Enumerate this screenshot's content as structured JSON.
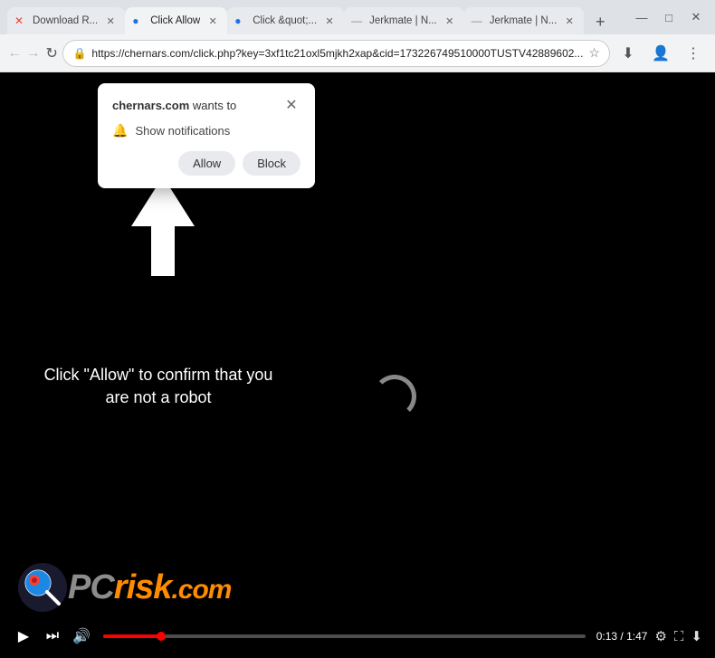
{
  "browser": {
    "tabs": [
      {
        "id": "tab1",
        "favicon": "✕",
        "title": "Download R...",
        "active": false,
        "favicon_color": "red"
      },
      {
        "id": "tab2",
        "favicon": "◉",
        "title": "Click Allow",
        "active": true,
        "favicon_color": "blue"
      },
      {
        "id": "tab3",
        "favicon": "◉",
        "title": "Click &quot;...",
        "active": false,
        "favicon_color": "blue"
      },
      {
        "id": "tab4",
        "favicon": "◉",
        "title": "Jerkmate | N...",
        "active": false,
        "favicon_color": "gray"
      },
      {
        "id": "tab5",
        "favicon": "◉",
        "title": "Jerkmate | N...",
        "active": false,
        "favicon_color": "gray"
      }
    ],
    "new_tab_label": "+",
    "window_controls": {
      "minimize": "—",
      "maximize": "□",
      "close": "✕"
    },
    "nav": {
      "back": "←",
      "forward": "→",
      "refresh": "↻"
    },
    "address": "https://chernars.com/click.php?key=3xf1tc21oxl5mjkh2xap&cid=173226749510000TUSTV42889602...",
    "address_icon": "🔒",
    "star_icon": "☆",
    "download_icon": "⬇",
    "profile_icon": "👤",
    "menu_icon": "⋮"
  },
  "popup": {
    "title_domain": "chernars.com",
    "title_suffix": " wants to",
    "close_icon": "✕",
    "notification_icon": "🔔",
    "notification_text": "Show notifications",
    "allow_label": "Allow",
    "block_label": "Block"
  },
  "page": {
    "background": "#000000",
    "instruction_text": "Click \"Allow\" to confirm that you are not a robot"
  },
  "video_controls": {
    "play_icon": "▶",
    "skip_icon": "⏭",
    "volume_icon": "🔊",
    "time_current": "0:13",
    "time_total": "1:47",
    "settings_icon": "⚙",
    "fullscreen_icon": "⛶",
    "download_icon": "⬇",
    "progress_percent": 12
  },
  "pcrisk": {
    "text_pc": "PC",
    "text_risk": "risk",
    "text_dotcom": ".com"
  }
}
